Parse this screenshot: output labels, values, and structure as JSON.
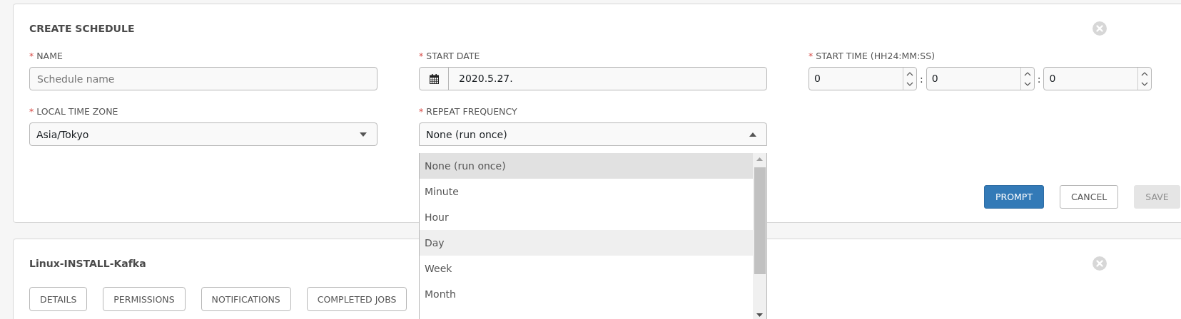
{
  "schedule_panel": {
    "title": "CREATE SCHEDULE",
    "name_field": {
      "label": "NAME",
      "required_mark": "*",
      "placeholder": "Schedule name"
    },
    "start_date": {
      "label": "START DATE",
      "required_mark": "*",
      "value": "2020.5.27."
    },
    "start_time": {
      "label": "START TIME (HH24:MM:SS)",
      "required_mark": "*",
      "separator": ":",
      "fields": [
        "0",
        "0",
        "0"
      ]
    },
    "time_zone": {
      "label": "LOCAL TIME ZONE",
      "required_mark": "*",
      "value": "Asia/Tokyo"
    },
    "repeat_frequency": {
      "label": "REPEAT FREQUENCY",
      "required_mark": "*",
      "value": "None (run once)",
      "expanded": true,
      "options": [
        {
          "label": "None (run once)",
          "selected": true,
          "hovered": false
        },
        {
          "label": "Minute",
          "selected": false,
          "hovered": false
        },
        {
          "label": "Hour",
          "selected": false,
          "hovered": false
        },
        {
          "label": "Day",
          "selected": false,
          "hovered": true
        },
        {
          "label": "Week",
          "selected": false,
          "hovered": false
        },
        {
          "label": "Month",
          "selected": false,
          "hovered": false
        }
      ]
    },
    "buttons": [
      {
        "label": "PROMPT",
        "kind": "primary",
        "disabled": false
      },
      {
        "label": "CANCEL",
        "kind": "default",
        "disabled": false
      },
      {
        "label": "SAVE",
        "kind": "default",
        "disabled": true
      }
    ]
  },
  "template_panel": {
    "title": "Linux-INSTALL-Kafka",
    "tabs": [
      {
        "label": "DETAILS",
        "selected": false
      },
      {
        "label": "PERMISSIONS",
        "selected": false
      },
      {
        "label": "NOTIFICATIONS",
        "selected": false
      },
      {
        "label": "COMPLETED JOBS",
        "selected": false
      }
    ]
  }
}
